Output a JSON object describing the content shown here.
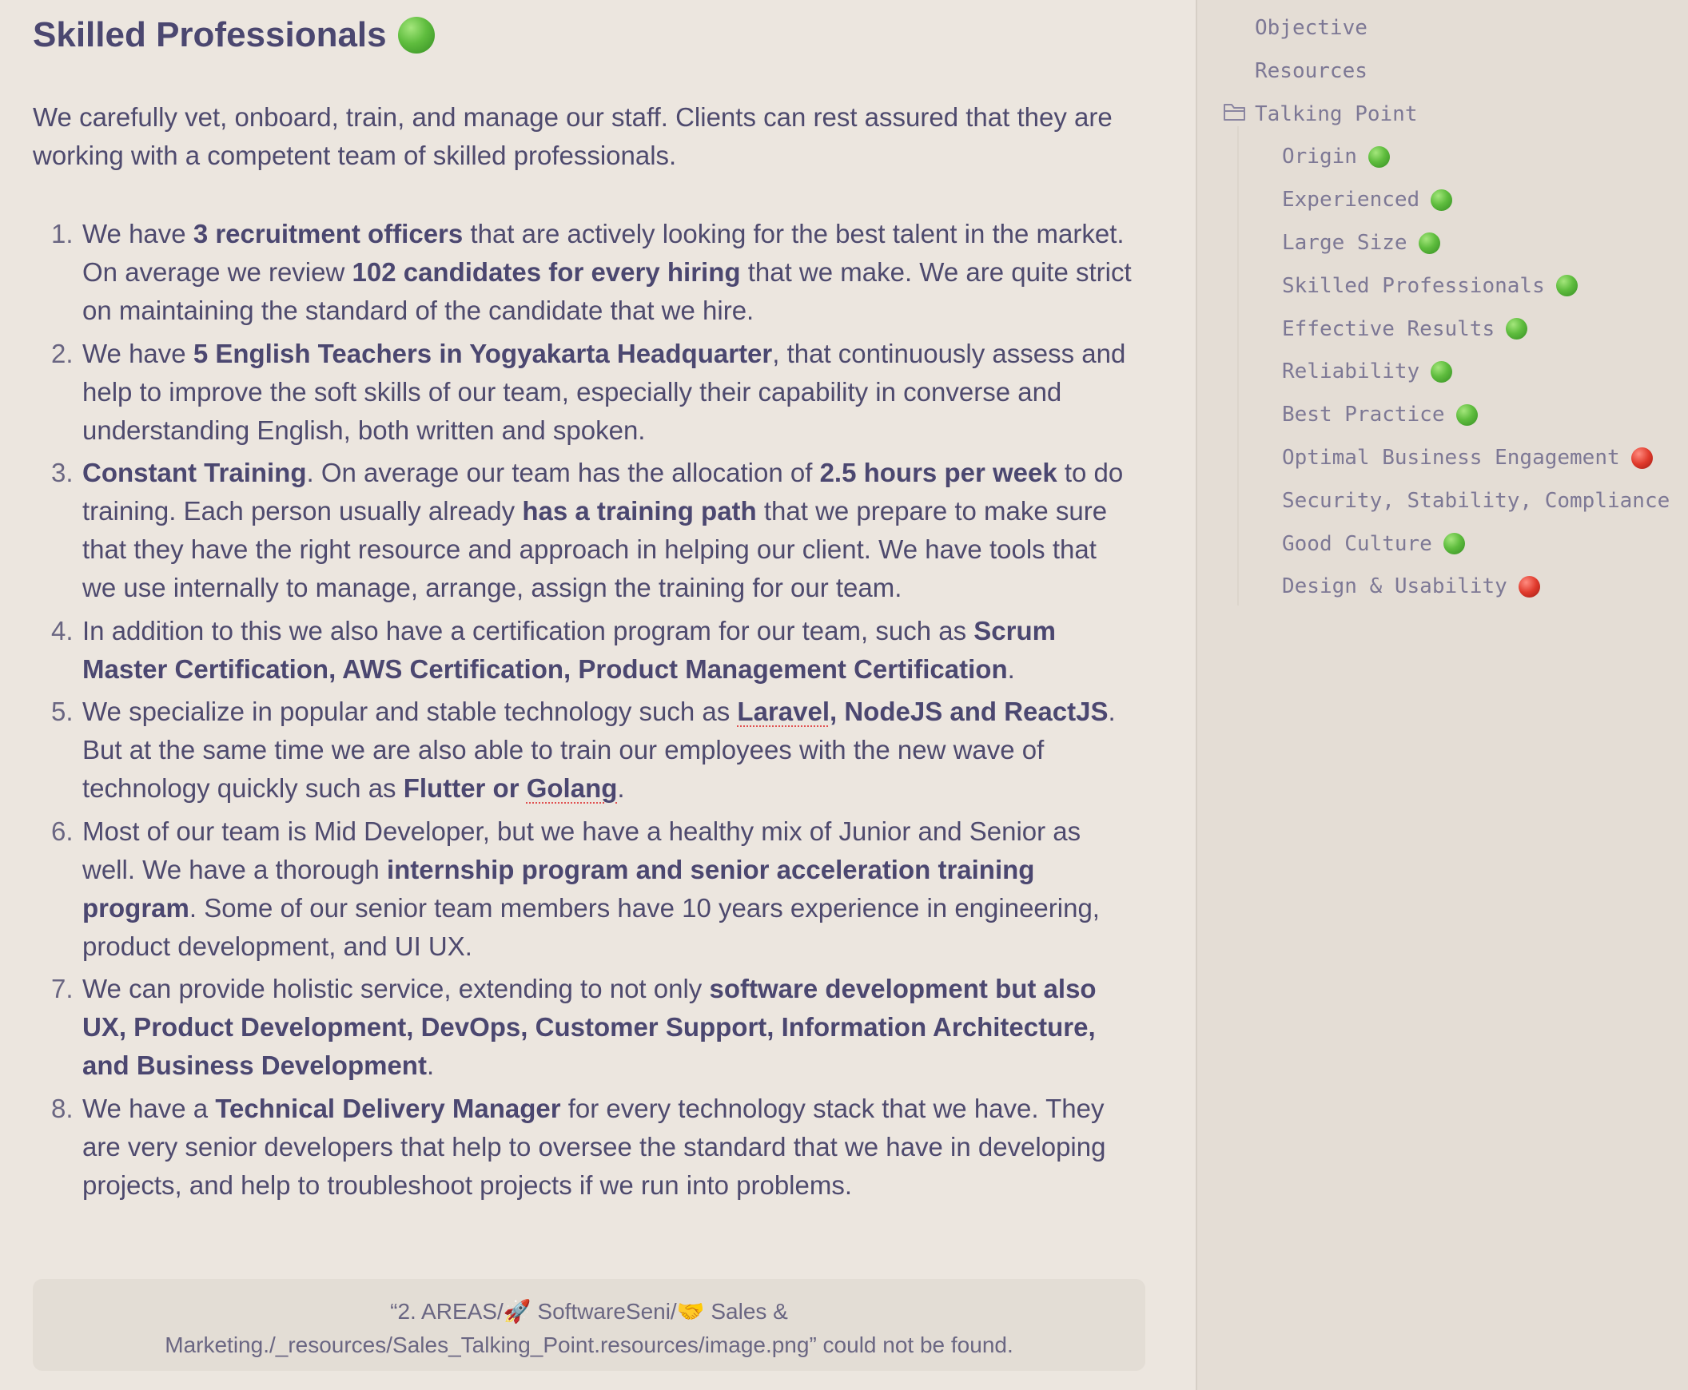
{
  "document": {
    "title": "Skilled Professionals",
    "title_status": "green",
    "intro": "We carefully vet, onboard, train, and manage our staff. Clients can rest assured that they are working with a competent team of skilled professionals.",
    "points": [
      {
        "number": "1.",
        "segments": [
          {
            "text": "We have "
          },
          {
            "text": "3 recruitment officers",
            "bold": true
          },
          {
            "text": " that are actively looking for the best talent in the market. On average we review "
          },
          {
            "text": "102 candidates for every hiring",
            "bold": true
          },
          {
            "text": " that we make. We are quite strict on maintaining the standard of the candidate that we hire."
          }
        ]
      },
      {
        "number": "2.",
        "segments": [
          {
            "text": "We have "
          },
          {
            "text": "5 English Teachers in Yogyakarta Headquarter",
            "bold": true
          },
          {
            "text": ", that continuously assess and help to improve the soft skills of our team, especially their capability in converse and understanding English, both written and spoken."
          }
        ]
      },
      {
        "number": "3.",
        "segments": [
          {
            "text": "Constant Training",
            "bold": true
          },
          {
            "text": ". On average our team has the allocation of "
          },
          {
            "text": "2.5 hours per week",
            "bold": true
          },
          {
            "text": " to do training. Each person usually already "
          },
          {
            "text": "has a training path",
            "bold": true
          },
          {
            "text": " that we prepare to make sure that they have the right resource and approach in helping our client. We have tools that we use internally to manage, arrange, assign the training for our team."
          }
        ]
      },
      {
        "number": "4.",
        "segments": [
          {
            "text": "In addition to this we also have a certification program for our team, such as "
          },
          {
            "text": "Scrum Master Certification, AWS Certification, Product Management Certification",
            "bold": true
          },
          {
            "text": "."
          }
        ]
      },
      {
        "number": "5.",
        "segments": [
          {
            "text": "We specialize in popular and stable technology such as "
          },
          {
            "text": "Laravel",
            "bold": true,
            "spell": true
          },
          {
            "text": ", NodeJS and ReactJS",
            "bold": true
          },
          {
            "text": ". But at the same time we are also able to train our employees with the new wave of technology quickly such as "
          },
          {
            "text": "Flutter or ",
            "bold": true
          },
          {
            "text": "Golang",
            "bold": true,
            "spell": true
          },
          {
            "text": "."
          }
        ]
      },
      {
        "number": "6.",
        "segments": [
          {
            "text": "Most of our team is Mid Developer, but we have a healthy mix of Junior and Senior as well. We have a thorough "
          },
          {
            "text": "internship program and senior acceleration training program",
            "bold": true
          },
          {
            "text": ". Some of our senior team members have 10 years experience in engineering, product development, and UI UX."
          }
        ]
      },
      {
        "number": "7.",
        "segments": [
          {
            "text": "We can provide holistic service, extending to not only "
          },
          {
            "text": "software development but also UX, Product Development, DevOps, Customer Support, Information Architecture, and Business Development",
            "bold": true
          },
          {
            "text": "."
          }
        ]
      },
      {
        "number": "8.",
        "segments": [
          {
            "text": "We have a "
          },
          {
            "text": "Technical Delivery Manager",
            "bold": true
          },
          {
            "text": " for every technology stack that we have. They are very senior developers that help to oversee the standard that we have in developing projects, and help to troubleshoot projects if we run into problems."
          }
        ]
      }
    ],
    "missing_image": {
      "line1": "“2. AREAS/🚀 SoftwareSeni/🤝 Sales &",
      "line2": "Marketing./_resources/Sales_Talking_Point.resources/image.png” could not be found."
    }
  },
  "outline": {
    "icons": {
      "folder": "folder-open-icon"
    },
    "items": [
      {
        "label": "Objective",
        "level": 0,
        "status": null
      },
      {
        "label": "Resources",
        "level": 0,
        "status": null
      },
      {
        "label": "Talking Point",
        "level": 0,
        "status": null,
        "folder": true
      },
      {
        "label": "Origin",
        "level": 1,
        "status": "green"
      },
      {
        "label": "Experienced",
        "level": 1,
        "status": "green"
      },
      {
        "label": "Large Size",
        "level": 1,
        "status": "green"
      },
      {
        "label": "Skilled Professionals",
        "level": 1,
        "status": "green"
      },
      {
        "label": "Effective Results",
        "level": 1,
        "status": "green"
      },
      {
        "label": "Reliability",
        "level": 1,
        "status": "green"
      },
      {
        "label": "Best Practice",
        "level": 1,
        "status": "green"
      },
      {
        "label": "Optimal Business Engagement",
        "level": 1,
        "status": "red"
      },
      {
        "label": "Security, Stability, Compliance",
        "level": 1,
        "status": null
      },
      {
        "label": "Good Culture",
        "level": 1,
        "status": "green"
      },
      {
        "label": "Design & Usability",
        "level": 1,
        "status": "red"
      }
    ]
  },
  "colors": {
    "background": "#ece6df",
    "sidebar_background": "#e4ddd5",
    "text": "#4e4a6e",
    "outline_text": "#7d7895",
    "status_green": "#4caf35",
    "status_red": "#d8352a"
  }
}
